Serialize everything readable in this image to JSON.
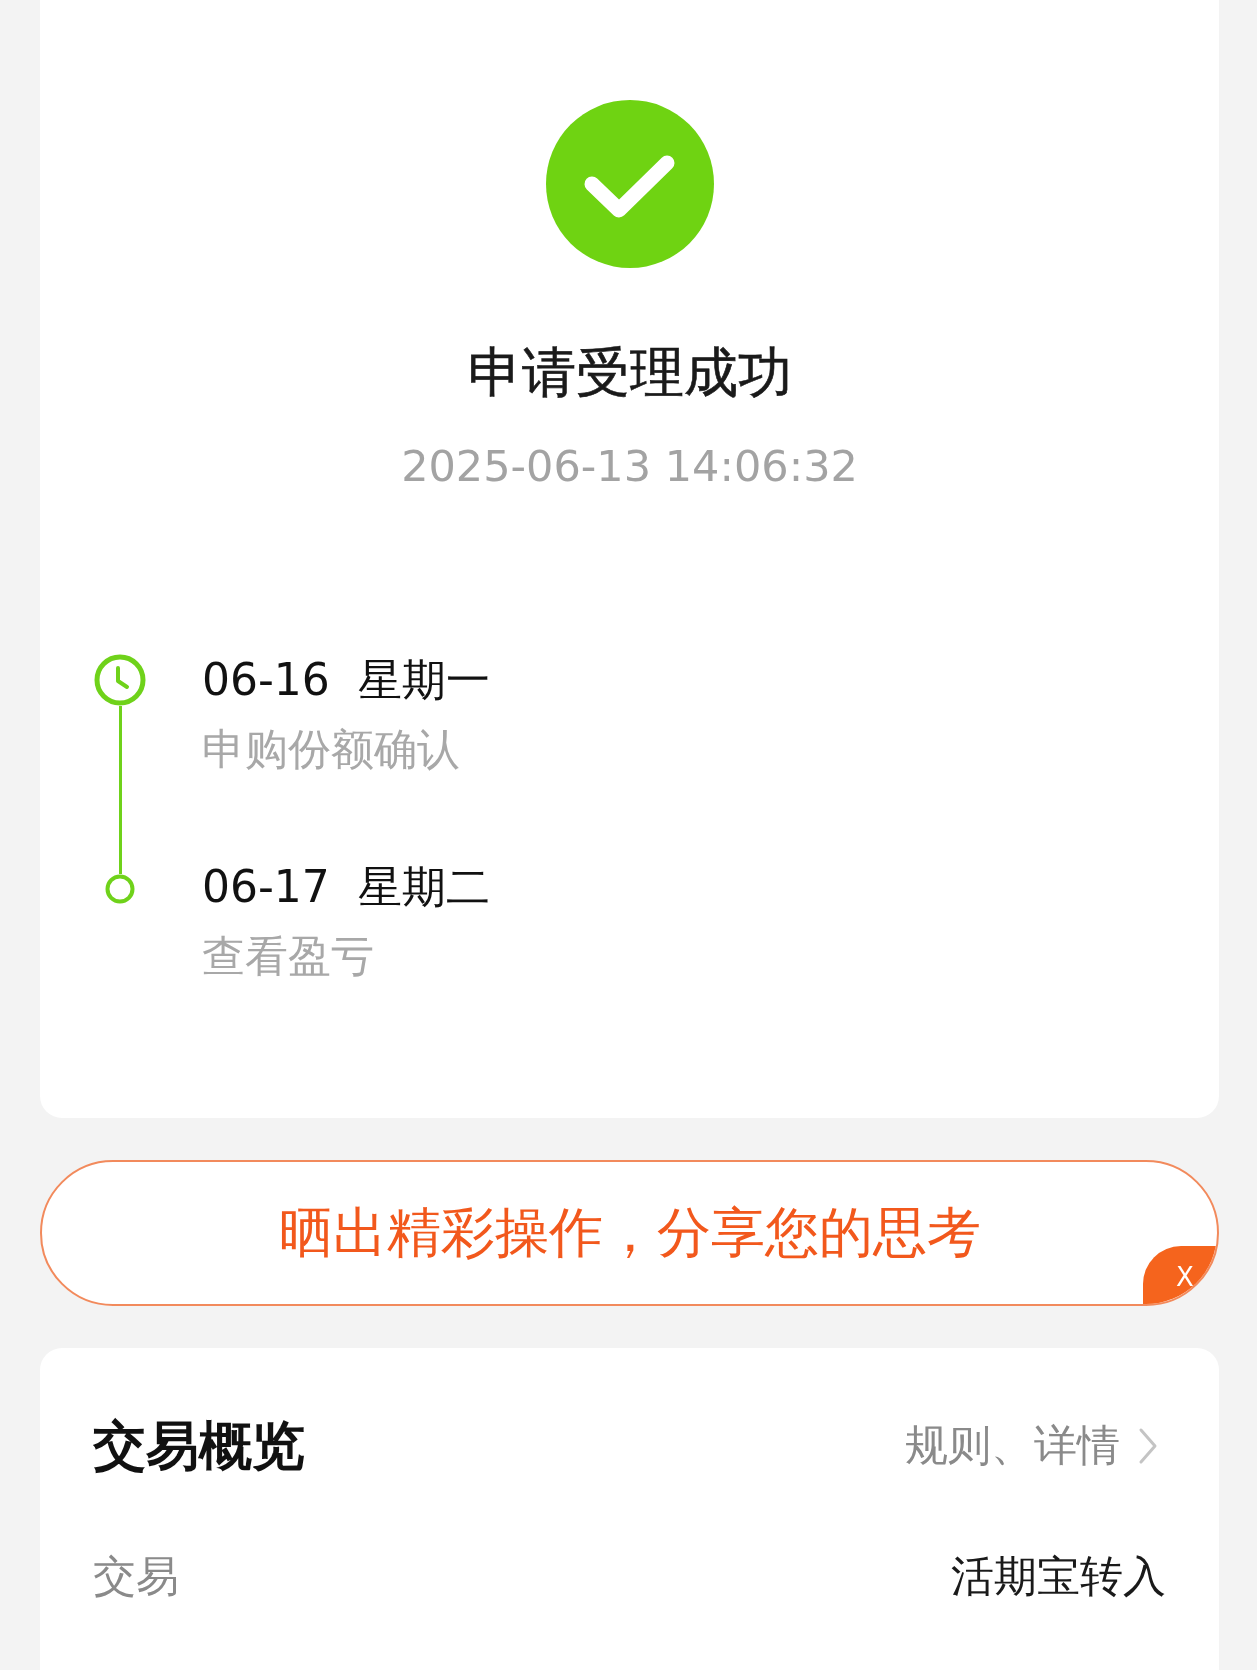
{
  "status": {
    "title": "申请受理成功",
    "time": "2025-06-13 14:06:32"
  },
  "timeline": [
    {
      "kind": "clock",
      "date": "06-16",
      "weekday": "星期一",
      "label": "申购份额确认"
    },
    {
      "kind": "ring",
      "date": "06-17",
      "weekday": "星期二",
      "label": "查看盈亏"
    }
  ],
  "share_banner": {
    "text": "晒出精彩操作，分享您的思考",
    "close": "X"
  },
  "overview": {
    "title": "交易概览",
    "link": "规则、详情",
    "rows": [
      {
        "label": "交易",
        "value": "活期宝转入"
      }
    ]
  }
}
